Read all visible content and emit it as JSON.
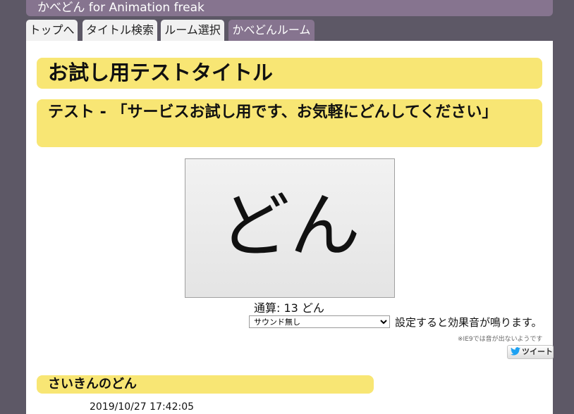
{
  "header": {
    "site_title": "かべどん for Animation freak"
  },
  "tabs": [
    {
      "label": "トップへ",
      "active": false
    },
    {
      "label": "タイトル検索",
      "active": false
    },
    {
      "label": "ルーム選択",
      "active": false
    },
    {
      "label": "かべどんルーム",
      "active": true
    }
  ],
  "main": {
    "page_title": "お試し用テストタイトル",
    "sub_title": "テスト - 「サービスお試し用です、お気軽にどんしてください」",
    "don_button_label": "どん",
    "counter_label": "通算: 13 どん",
    "sound_select": {
      "selected": "サウンド無し"
    },
    "sound_note": "設定すると効果音が鳴ります。",
    "ie_note": "※IE9では音が出ないようです",
    "tweet_label": "ツイート",
    "recent_section_title": "さいきんのどん",
    "recent_entry": "2019/10/27 17:42:05"
  },
  "colors": {
    "accent": "#86748f",
    "background": "#5d5866",
    "highlight": "#f8e674",
    "twitter": "#1da1f2"
  }
}
